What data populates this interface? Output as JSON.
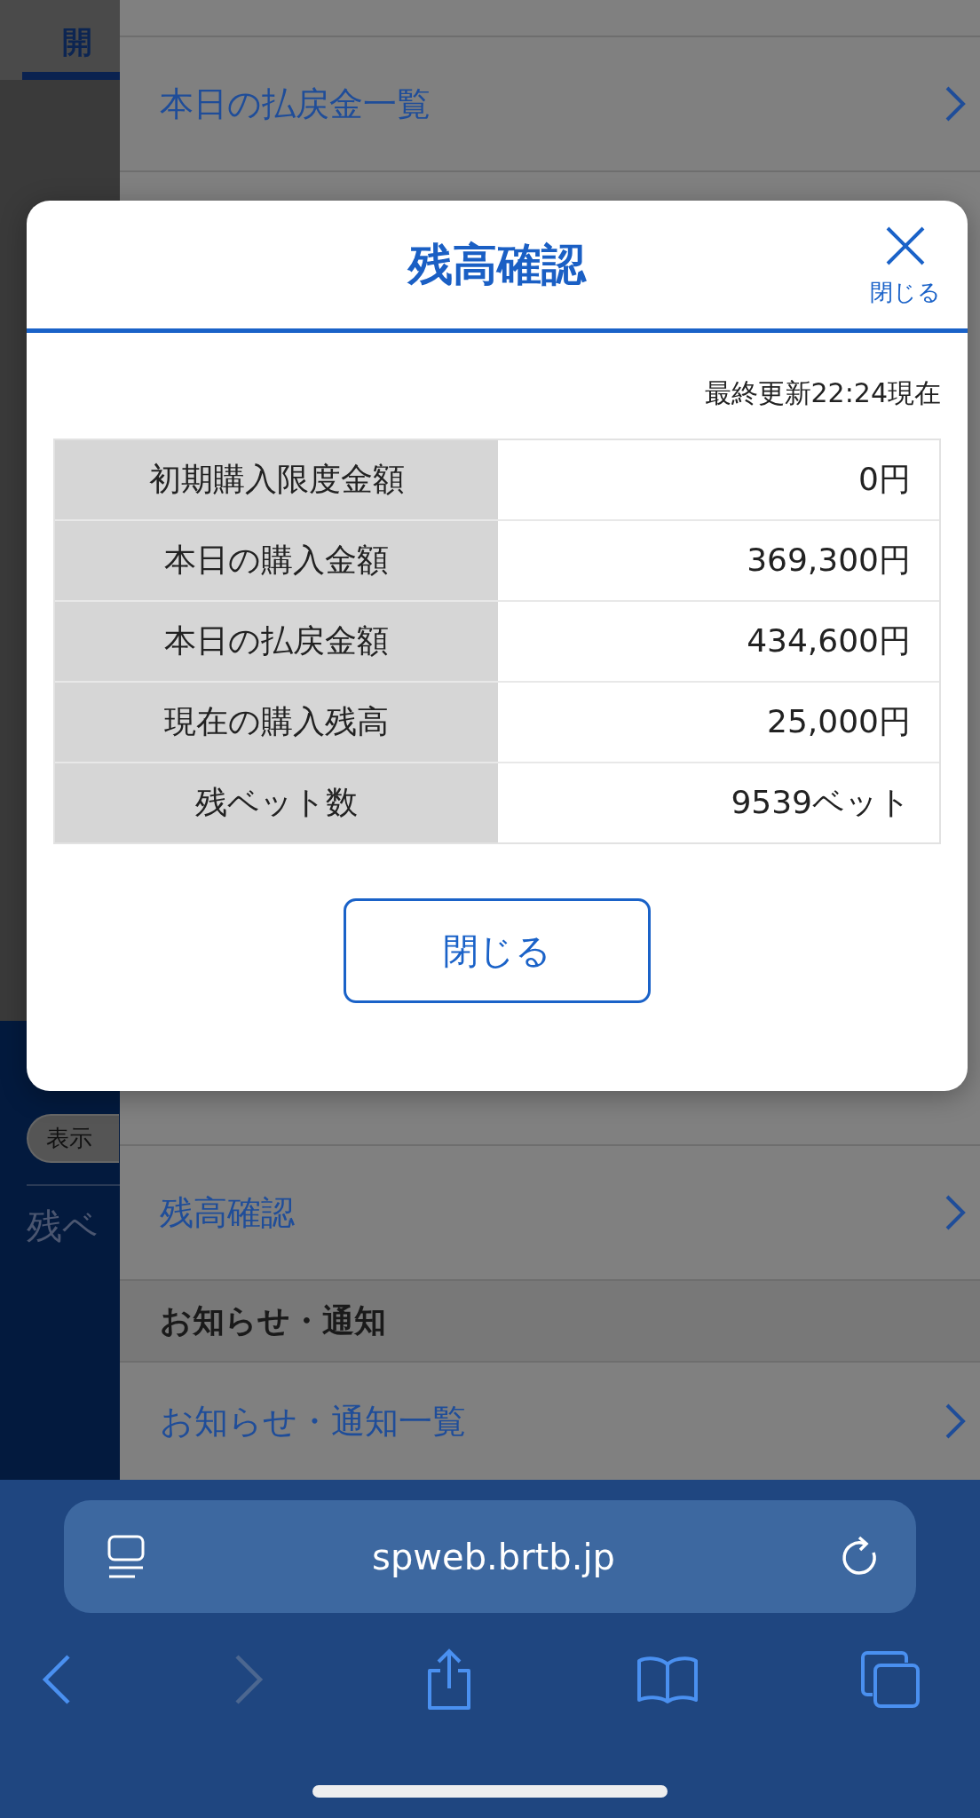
{
  "background": {
    "tab": "開",
    "pill": "表示",
    "label": "残ベ"
  },
  "menu": {
    "items": [
      {
        "kind": "link",
        "label": "本日の払戻金一覧"
      },
      {
        "kind": "hidden"
      },
      {
        "kind": "link",
        "label": "残高確認"
      },
      {
        "kind": "header",
        "label": "お知らせ・通知"
      },
      {
        "kind": "link",
        "label": "お知らせ・通知一覧"
      }
    ]
  },
  "modal": {
    "title": "残高確認",
    "close_label": "閉じる",
    "updated": "最終更新22:24現在",
    "rows": [
      {
        "label": "初期購入限度金額",
        "value": "0円"
      },
      {
        "label": "本日の購入金額",
        "value": "369,300円"
      },
      {
        "label": "本日の払戻金額",
        "value": "434,600円"
      },
      {
        "label": "現在の購入残高",
        "value": "25,000円"
      },
      {
        "label": "残ベット数",
        "value": "9539ベット"
      }
    ],
    "button": "閉じる"
  },
  "browser": {
    "url": "spweb.brtb.jp",
    "toolbar": [
      {
        "kind": "back",
        "disabled": false
      },
      {
        "kind": "forward",
        "disabled": true
      },
      {
        "kind": "share",
        "disabled": false
      },
      {
        "kind": "bookmarks",
        "disabled": false
      },
      {
        "kind": "tabs",
        "disabled": false
      }
    ]
  }
}
